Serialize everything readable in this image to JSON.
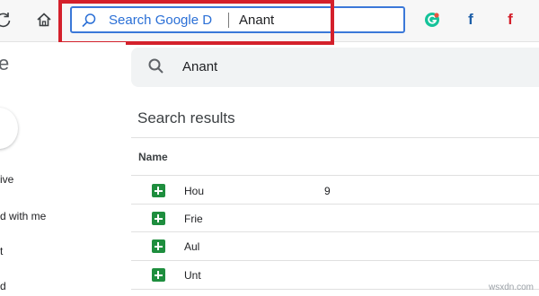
{
  "browser": {
    "omnibox": {
      "engine_label": "Search Google D",
      "query": "Anant"
    },
    "extensions": [
      {
        "icon": "grammarly-icon",
        "color": "#15c39a"
      },
      {
        "icon": "facebook-icon",
        "label": "f",
        "color": "#1d5fa8"
      },
      {
        "icon": "flipboard-icon",
        "label": "f",
        "color": "#d4202b"
      }
    ]
  },
  "sidebar": {
    "app_title_fragment": "e",
    "items": [
      {
        "label": "ive"
      },
      {
        "label": "d with me"
      },
      {
        "label": "t"
      },
      {
        "label": "d"
      }
    ]
  },
  "search": {
    "query": "Anant"
  },
  "results": {
    "title": "Search results",
    "column_name": "Name",
    "rows": [
      {
        "name": "Hou",
        "extra": "9"
      },
      {
        "name": "Frie",
        "extra": ""
      },
      {
        "name": "Aul",
        "extra": ""
      },
      {
        "name": "Unt",
        "extra": ""
      }
    ]
  },
  "watermark": "wsxdn.com",
  "colors": {
    "highlight": "#d4202b",
    "omnibox_border": "#3b78d8",
    "sheets_green": "#1e8e3e"
  }
}
